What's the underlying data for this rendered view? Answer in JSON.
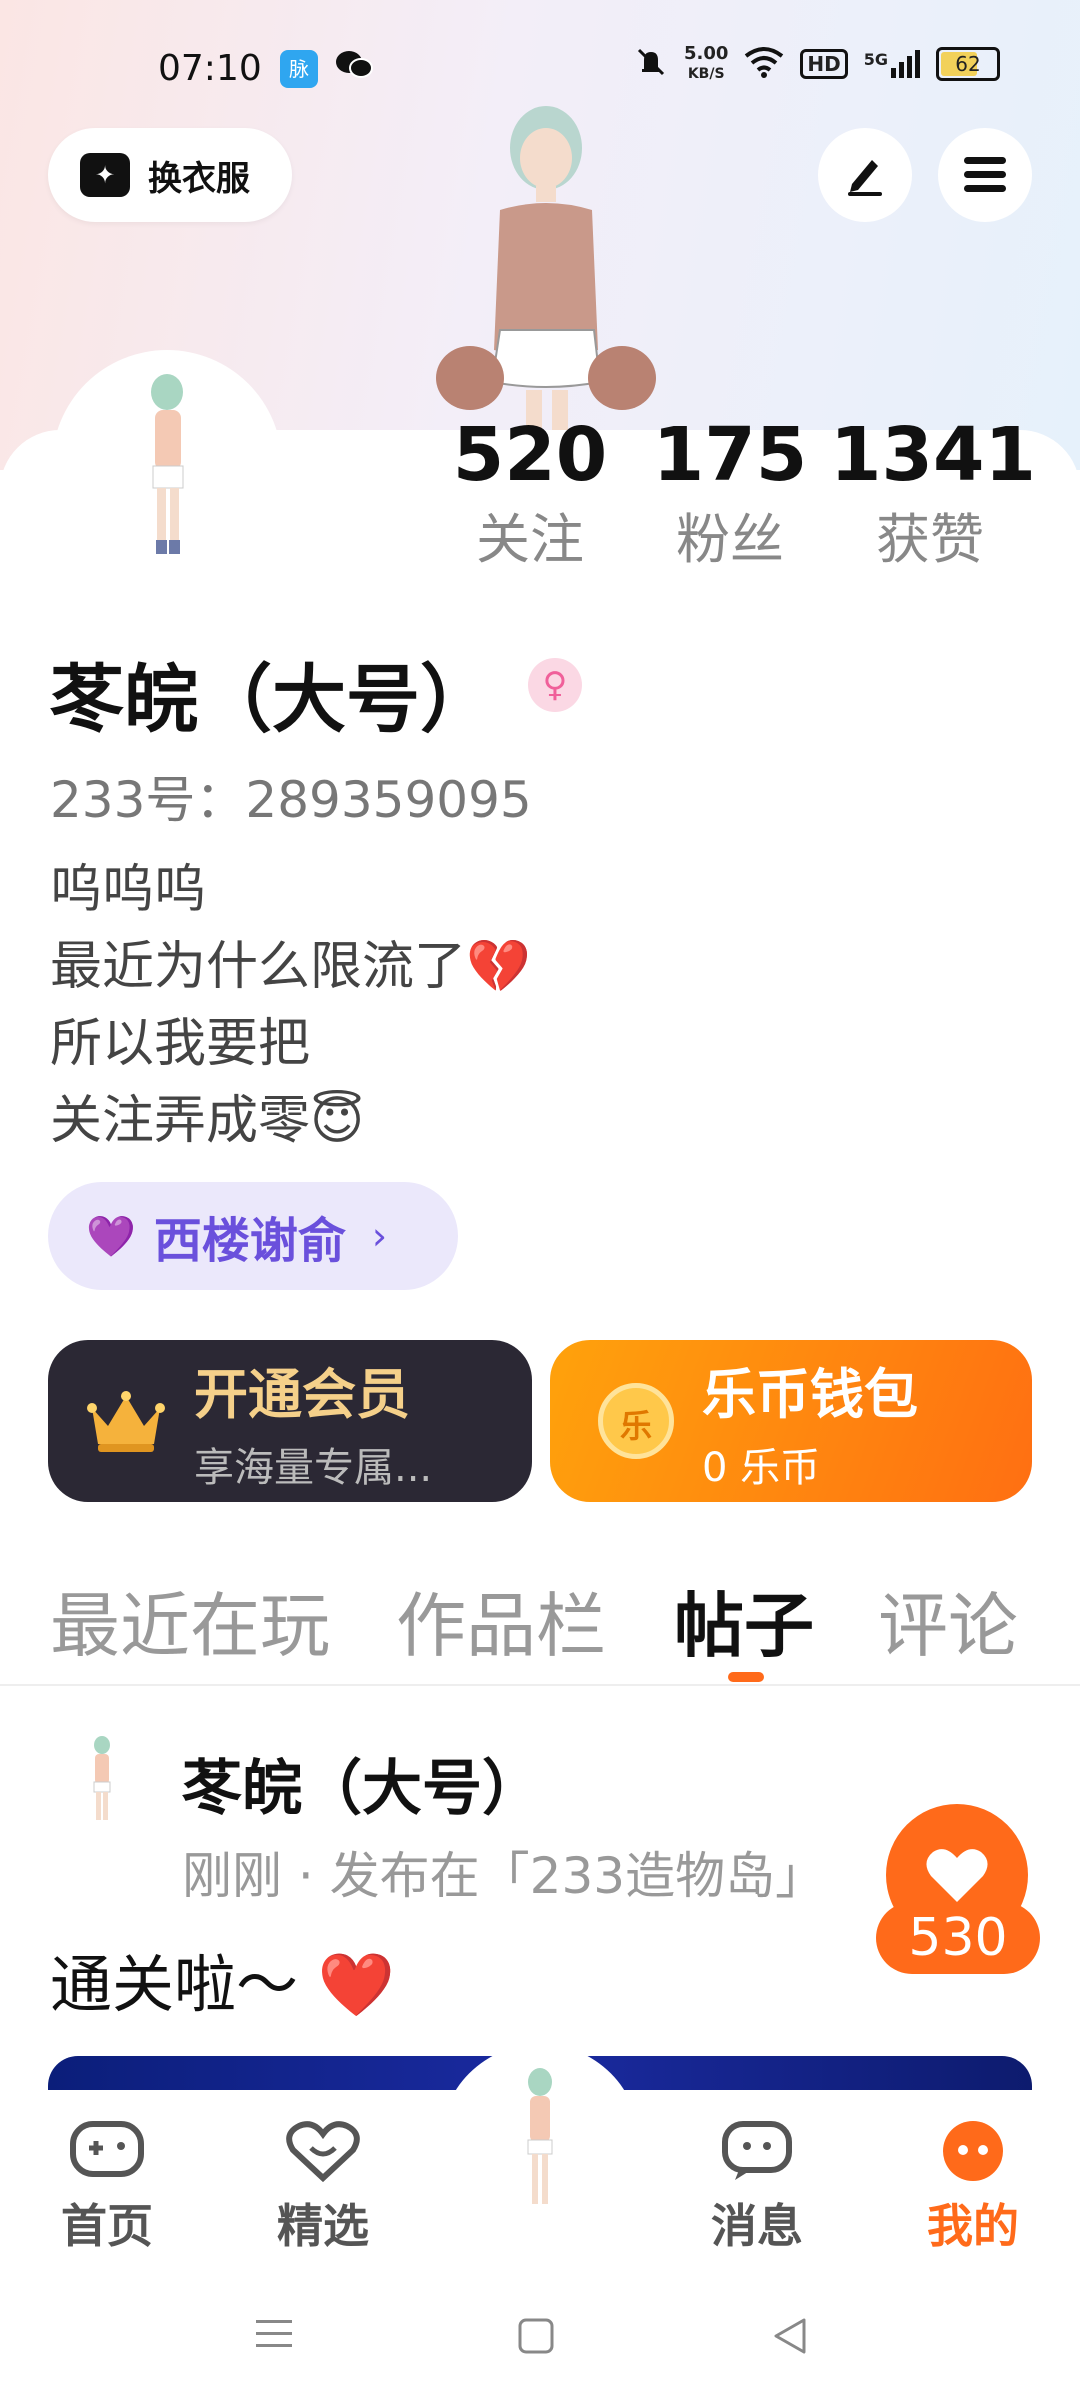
{
  "status_bar": {
    "time": "07:10",
    "app_icon_1": "脉",
    "network_speed_value": "5.00",
    "network_speed_unit": "KB/S",
    "hd": "HD",
    "signal": "5G",
    "battery": "62"
  },
  "header": {
    "wardrobe_label": "换衣服",
    "icons": [
      "shirt-icon",
      "edit-icon",
      "menu-icon"
    ]
  },
  "profile": {
    "stats": [
      {
        "value": "520",
        "label": "关注"
      },
      {
        "value": "175",
        "label": "粉丝"
      },
      {
        "value": "1341",
        "label": "获赞"
      }
    ],
    "name": "苳皖（大号）",
    "gender_symbol": "♀",
    "id_line": "233号：289359095",
    "bio": [
      "呜呜呜",
      "最近为什么限流了💔",
      "所以我要把",
      "关注弄成零😇"
    ],
    "tag": {
      "label": "西楼谢俞",
      "chevron": "›"
    }
  },
  "cards": {
    "vip": {
      "title": "开通会员",
      "subtitle": "享海量专属..."
    },
    "wallet": {
      "title": "乐币钱包",
      "subtitle": "0 乐币",
      "coin_char": "乐"
    }
  },
  "tabs": [
    {
      "label": "最近在玩",
      "active": false
    },
    {
      "label": "作品栏",
      "active": false
    },
    {
      "label": "帖子",
      "active": true
    },
    {
      "label": "评论",
      "active": false
    }
  ],
  "post": {
    "author": "苳皖（大号）",
    "meta": "刚刚 · 发布在「233造物岛」",
    "text": "通关啦～ ❤️",
    "likes": "530"
  },
  "bottom_nav": [
    {
      "label": "首页",
      "icon": "gamepad-icon",
      "active": false
    },
    {
      "label": "精选",
      "icon": "heart-chat-icon",
      "active": false
    },
    {
      "label": "消息",
      "icon": "message-icon",
      "active": false
    },
    {
      "label": "我的",
      "icon": "profile-face-icon",
      "active": true
    }
  ],
  "colors": {
    "accent": "#ff6a1a",
    "tag_purple": "#6a50dc",
    "vip_gold": "#f5d08a"
  }
}
